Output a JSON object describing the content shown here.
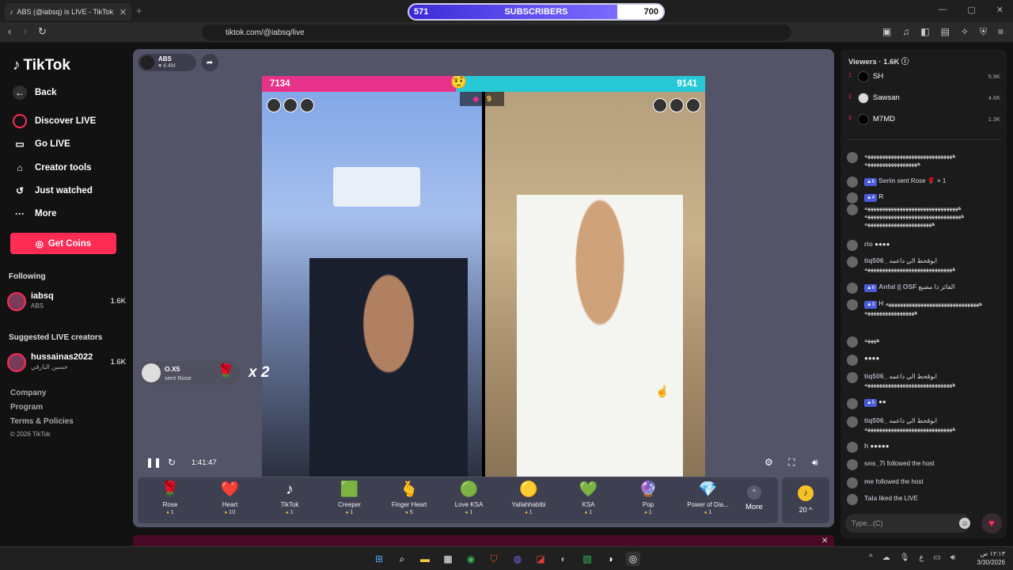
{
  "browser": {
    "tab_title": "ABS (@iabsq) is LIVE - TikTok",
    "url": "tiktok.com/@iabsq/live",
    "subscribers": {
      "left": "571",
      "label": "SUBSCRIBERS",
      "right": "700",
      "progress": 0.82
    }
  },
  "sidebar": {
    "logo": "TikTok",
    "nav": [
      {
        "label": "Back",
        "icon": "back-arrow-icon"
      },
      {
        "label": "Discover LIVE",
        "icon": "live-icon"
      },
      {
        "label": "Go LIVE",
        "icon": "camera-icon"
      },
      {
        "label": "Creator tools",
        "icon": "house-icon"
      },
      {
        "label": "Just watched",
        "icon": "history-icon"
      },
      {
        "label": "More",
        "icon": "more-dots-icon"
      }
    ],
    "get_coins": "Get Coins",
    "following_header": "Following",
    "following": [
      {
        "name": "iabsq",
        "sub": "ABS",
        "count": "1.6K"
      }
    ],
    "suggested_header": "Suggested LIVE creators",
    "suggested": [
      {
        "name": "hussainas2022",
        "sub": "حسين البارقي",
        "count": "1.6K"
      }
    ],
    "footer": [
      "Company",
      "Program",
      "Terms & Policies",
      "© 2026 TikTok"
    ]
  },
  "stream": {
    "host_name": "ABS",
    "host_likes": "♥ 4.4M",
    "score_left": "7134",
    "score_right": "9141",
    "left_fraction": 0.438,
    "round": "9",
    "gift_notice": {
      "user": "O.X5",
      "action": "sent Rose",
      "multiplier": "x 2"
    },
    "time": "1:41:47"
  },
  "gifts": [
    {
      "name": "Rose",
      "price": "1",
      "icon": "🌹"
    },
    {
      "name": "Heart",
      "price": "10",
      "icon": "❤️"
    },
    {
      "name": "TikTok",
      "price": "1",
      "icon": "♪"
    },
    {
      "name": "Creeper",
      "price": "1",
      "icon": "🟩"
    },
    {
      "name": "Finger Heart",
      "price": "5",
      "icon": "🫰"
    },
    {
      "name": "Love KSA",
      "price": "1",
      "icon": "🟢"
    },
    {
      "name": "Yallahhabibi",
      "price": "1",
      "icon": "🟡"
    },
    {
      "name": "KSA",
      "price": "1",
      "icon": "💚"
    },
    {
      "name": "Pop",
      "price": "1",
      "icon": "🔮"
    },
    {
      "name": "Power of Dia...",
      "price": "1",
      "icon": "💎"
    }
  ],
  "more_label": "More",
  "coins": "20",
  "viewers": {
    "header": "Viewers · 1.6K",
    "list": [
      {
        "rank": "1",
        "name": "SH",
        "score": "5.9K"
      },
      {
        "rank": "2",
        "name": "Sawsan",
        "score": "4.6K"
      },
      {
        "rank": "3",
        "name": "M7MD",
        "score": "1.3K"
      }
    ]
  },
  "chat": [
    {
      "name": "",
      "text": "ههههههههههههههههههههههههههههههه ههههههههههههههههههه",
      "badge": ""
    },
    {
      "name": "Serin",
      "text": "sent Rose 🌹 × 1",
      "badge": "6"
    },
    {
      "name": "R",
      "text": "",
      "badge": "4"
    },
    {
      "name": "",
      "text": "ههههههههههههههههههههههههههههههههه هههههههههههههههههههههههههههههههههه هههههههههههههههههههههههه",
      "badge": ""
    },
    {
      "name": "rio",
      "text": "●●●●",
      "badge": ""
    },
    {
      "name": "tiq506_",
      "text": "ابوقحط الي داعمه ههههههههههههههههههههههههههههههه",
      "badge": ""
    },
    {
      "name": "Anfal || OSF",
      "text": "الفائز ذا مضيع",
      "badge": "6"
    },
    {
      "name": "H",
      "text": "ههههههههههههههههههههههههههههههههه هههههههههههههههههه",
      "badge": "3"
    },
    {
      "name": "",
      "text": "ههههه",
      "badge": ""
    },
    {
      "name": "",
      "text": "●●●●",
      "badge": ""
    },
    {
      "name": "tiq506_",
      "text": "ابوقحط الي داعمه ههههههههههههههههههههههههههههههه",
      "badge": ""
    },
    {
      "name": "",
      "text": "●●",
      "badge": "5"
    },
    {
      "name": "tiq506_",
      "text": "ابوقحط الي داعمه ههههههههههههههههههههههههههههههه",
      "badge": ""
    },
    {
      "name": "h",
      "text": "●●●●●",
      "badge": ""
    },
    {
      "name": "sns_7i",
      "text": "followed the host",
      "badge": ""
    },
    {
      "name": "me",
      "text": "followed the host",
      "badge": ""
    },
    {
      "name": "Tala",
      "text": "liked the LIVE",
      "badge": ""
    }
  ],
  "chat_placeholder": "Type...(C)",
  "clock": {
    "time": "١٢:١٣ ص",
    "date": "3/30/2026"
  }
}
